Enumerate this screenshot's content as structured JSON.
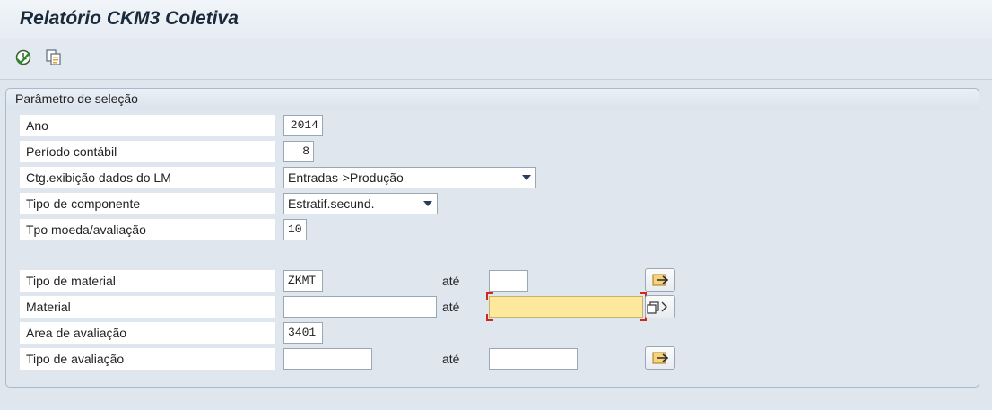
{
  "window": {
    "title": "Relatório CKM3 Coletiva"
  },
  "toolbar": {
    "items": [
      {
        "icon": "execute-icon"
      },
      {
        "icon": "get-variant-icon"
      }
    ]
  },
  "panel": {
    "title": "Parâmetro de seleção"
  },
  "fields": {
    "ano": {
      "label": "Ano",
      "value": "2014"
    },
    "periodo": {
      "label": "Período contábil",
      "value": "8"
    },
    "ctg": {
      "label": "Ctg.exibição dados do LM",
      "value": "Entradas->Produção"
    },
    "tipo_componente": {
      "label": "Tipo de componente",
      "value": "Estratif.secund."
    },
    "tpo_moeda": {
      "label": "Tpo moeda/avaliação",
      "value": "10"
    },
    "tipo_material": {
      "label": "Tipo de material",
      "from": "ZKMT",
      "to_label": "até",
      "to": ""
    },
    "material": {
      "label": "Material",
      "from": "",
      "to_label": "até",
      "to": ""
    },
    "area_avaliacao": {
      "label": "Área de avaliação",
      "value": "3401"
    },
    "tipo_avaliacao": {
      "label": "Tipo de avaliação",
      "from": "",
      "to_label": "até",
      "to": ""
    }
  },
  "colors": {
    "background": "#dfe6ee",
    "focus_field": "#fde89c",
    "focus_marker": "#d0281c",
    "multi_button": "#e8b84a"
  }
}
